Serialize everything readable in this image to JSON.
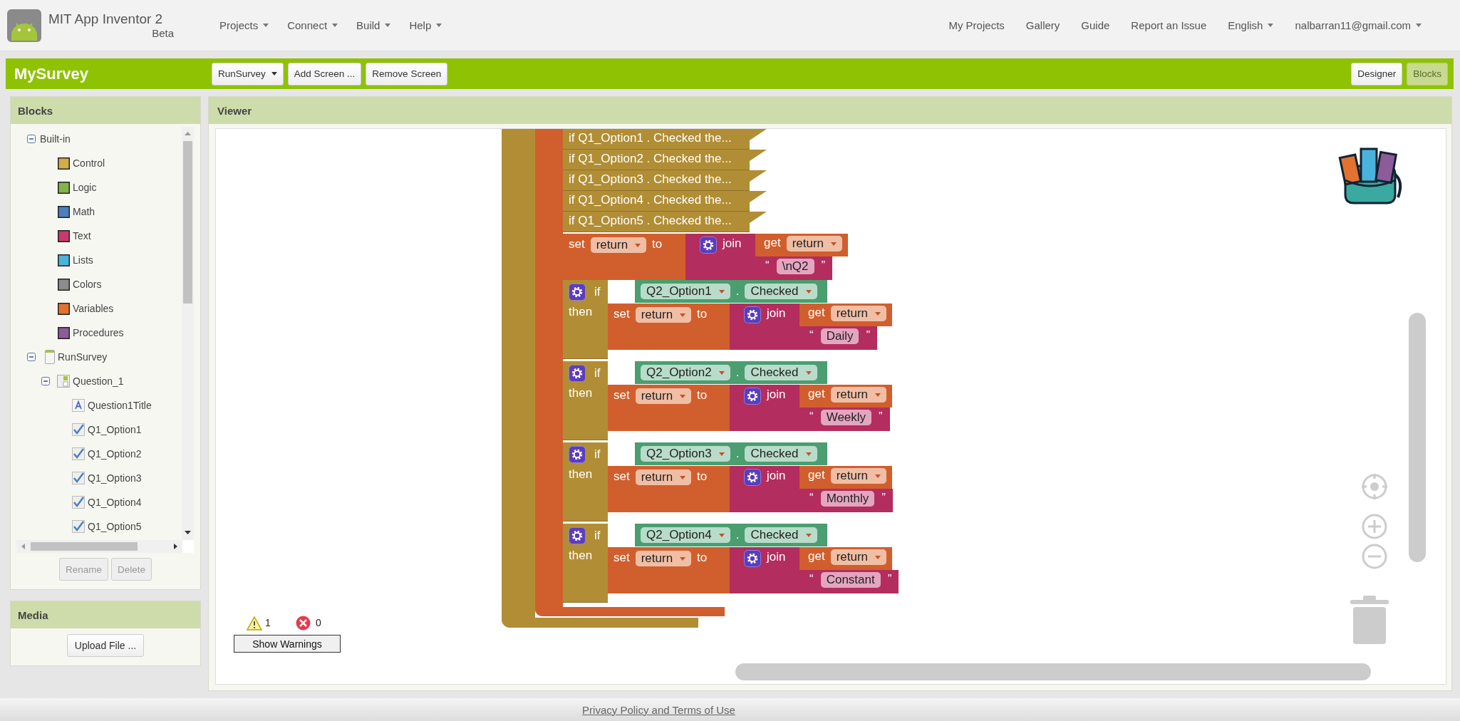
{
  "header": {
    "app_title": "MIT App Inventor 2",
    "edition": "Beta",
    "menus": [
      {
        "label": "Projects"
      },
      {
        "label": "Connect"
      },
      {
        "label": "Build"
      },
      {
        "label": "Help"
      }
    ],
    "links": [
      {
        "label": "My Projects",
        "kind": "link"
      },
      {
        "label": "Gallery",
        "kind": "link"
      },
      {
        "label": "Guide",
        "kind": "link"
      },
      {
        "label": "Report an Issue",
        "kind": "link"
      },
      {
        "label": "English",
        "kind": "menu"
      },
      {
        "label": "nalbarran11@gmail.com",
        "kind": "menu"
      }
    ]
  },
  "project_bar": {
    "project_name": "MySurvey",
    "screen_selector": "RunSurvey",
    "buttons": [
      "Add Screen ...",
      "Remove Screen"
    ],
    "views": [
      {
        "label": "Designer",
        "selected": false
      },
      {
        "label": "Blocks",
        "selected": true
      }
    ]
  },
  "blocks_panel": {
    "title": "Blocks",
    "tree": [
      {
        "label": "Built-in",
        "kind": "group",
        "expanded": true,
        "children": [
          {
            "label": "Control",
            "kind": "category",
            "color": "#d4ac48"
          },
          {
            "label": "Logic",
            "kind": "category",
            "color": "#82b548"
          },
          {
            "label": "Math",
            "kind": "category",
            "color": "#4a7fc1"
          },
          {
            "label": "Text",
            "kind": "category",
            "color": "#c9396b"
          },
          {
            "label": "Lists",
            "kind": "category",
            "color": "#4ab3dc"
          },
          {
            "label": "Colors",
            "kind": "category",
            "color": "#8c8c8c"
          },
          {
            "label": "Variables",
            "kind": "category",
            "color": "#e2722f"
          },
          {
            "label": "Procedures",
            "kind": "category",
            "color": "#8e5b99"
          }
        ]
      },
      {
        "label": "RunSurvey",
        "kind": "screen",
        "expanded": true,
        "children": [
          {
            "label": "Question_1",
            "kind": "arrangement",
            "expanded": true,
            "children": [
              {
                "label": "Question1Title",
                "kind": "label"
              },
              {
                "label": "Q1_Option1",
                "kind": "checkbox"
              },
              {
                "label": "Q1_Option2",
                "kind": "checkbox"
              },
              {
                "label": "Q1_Option3",
                "kind": "checkbox"
              },
              {
                "label": "Q1_Option4",
                "kind": "checkbox"
              },
              {
                "label": "Q1_Option5",
                "kind": "checkbox"
              }
            ]
          }
        ]
      }
    ],
    "buttons": [
      {
        "label": "Rename",
        "disabled": true
      },
      {
        "label": "Delete",
        "disabled": true
      }
    ]
  },
  "media_panel": {
    "title": "Media",
    "button": "Upload File ..."
  },
  "viewer": {
    "title": "Viewer",
    "collapsed_blocks": [
      {
        "text": "if Q1_Option1 . Checked the..."
      },
      {
        "text": "if Q1_Option2 . Checked the..."
      },
      {
        "text": "if Q1_Option3 . Checked the..."
      },
      {
        "text": "if Q1_Option4 . Checked the..."
      },
      {
        "text": "if Q1_Option5 . Checked the..."
      }
    ],
    "set_block": {
      "set": "set",
      "variable": "return",
      "to": "to",
      "join": "join",
      "get": "get",
      "get_variable": "return",
      "open_quote": "“",
      "text": "\\nQ2",
      "close_quote": "”"
    },
    "if_blocks": [
      {
        "if": "if",
        "then": "then",
        "component": "Q2_Option1",
        "dot": ".",
        "property": "Checked",
        "action": {
          "set": "set",
          "variable": "return",
          "to": "to",
          "join": "join",
          "get": "get",
          "get_variable": "return",
          "open_quote": "“",
          "text": "Daily",
          "close_quote": "”"
        }
      },
      {
        "if": "if",
        "then": "then",
        "component": "Q2_Option2",
        "dot": ".",
        "property": "Checked",
        "action": {
          "set": "set",
          "variable": "return",
          "to": "to",
          "join": "join",
          "get": "get",
          "get_variable": "return",
          "open_quote": "“",
          "text": "Weekly",
          "close_quote": "”"
        }
      },
      {
        "if": "if",
        "then": "then",
        "component": "Q2_Option3",
        "dot": ".",
        "property": "Checked",
        "action": {
          "set": "set",
          "variable": "return",
          "to": "to",
          "join": "join",
          "get": "get",
          "get_variable": "return",
          "open_quote": "“",
          "text": "Monthly",
          "close_quote": "”"
        }
      },
      {
        "if": "if",
        "then": "then",
        "component": "Q2_Option4",
        "dot": ".",
        "property": "Checked",
        "action": {
          "set": "set",
          "variable": "return",
          "to": "to",
          "join": "join",
          "get": "get",
          "get_variable": "return",
          "open_quote": "“",
          "text": "Constant",
          "close_quote": "”"
        }
      }
    ],
    "warnings": {
      "warning_count": "1",
      "error_count": "0",
      "button": "Show Warnings"
    }
  },
  "footer": {
    "link": "Privacy Policy and Terms of Use"
  }
}
